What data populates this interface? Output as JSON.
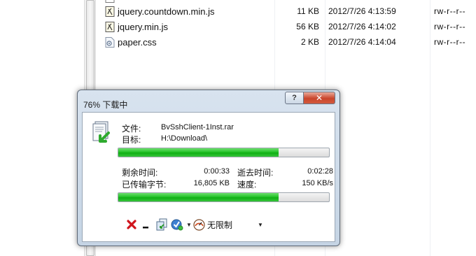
{
  "files": [
    {
      "name": "jquery.countdown.min.js",
      "size": "11 KB",
      "date": "2012/7/26 4:13:59",
      "perms": "rw-r--r--",
      "icon": "js-file-icon"
    },
    {
      "name": "jquery.min.js",
      "size": "56 KB",
      "date": "2012/7/26 4:14:02",
      "perms": "rw-r--r--",
      "icon": "js-file-icon"
    },
    {
      "name": "paper.css",
      "size": "2 KB",
      "date": "2012/7/26 4:14:04",
      "perms": "rw-r--r--",
      "icon": "css-file-icon"
    }
  ],
  "dialog": {
    "title": "76% 下载中",
    "help_label": "?",
    "close_label": "✕",
    "file_label": "文件:",
    "file_value": "BvSshClient-1Inst.rar",
    "target_label": "目标:",
    "target_value": "H:\\Download\\",
    "progress": 0.76,
    "remaining_label": "剩余时间:",
    "remaining_value": "0:00:33",
    "elapsed_label": "逝去时间:",
    "elapsed_value": "0:02:28",
    "transferred_label": "已传输字节:",
    "transferred_value": "16,805 KB",
    "speed_label": "速度:",
    "speed_value": "150 KB/s",
    "speed_limit": "无限制",
    "colors": {
      "progress_green": "#1bbd20",
      "cancel_red": "#d0141c",
      "close_red": "#c9452c"
    }
  }
}
